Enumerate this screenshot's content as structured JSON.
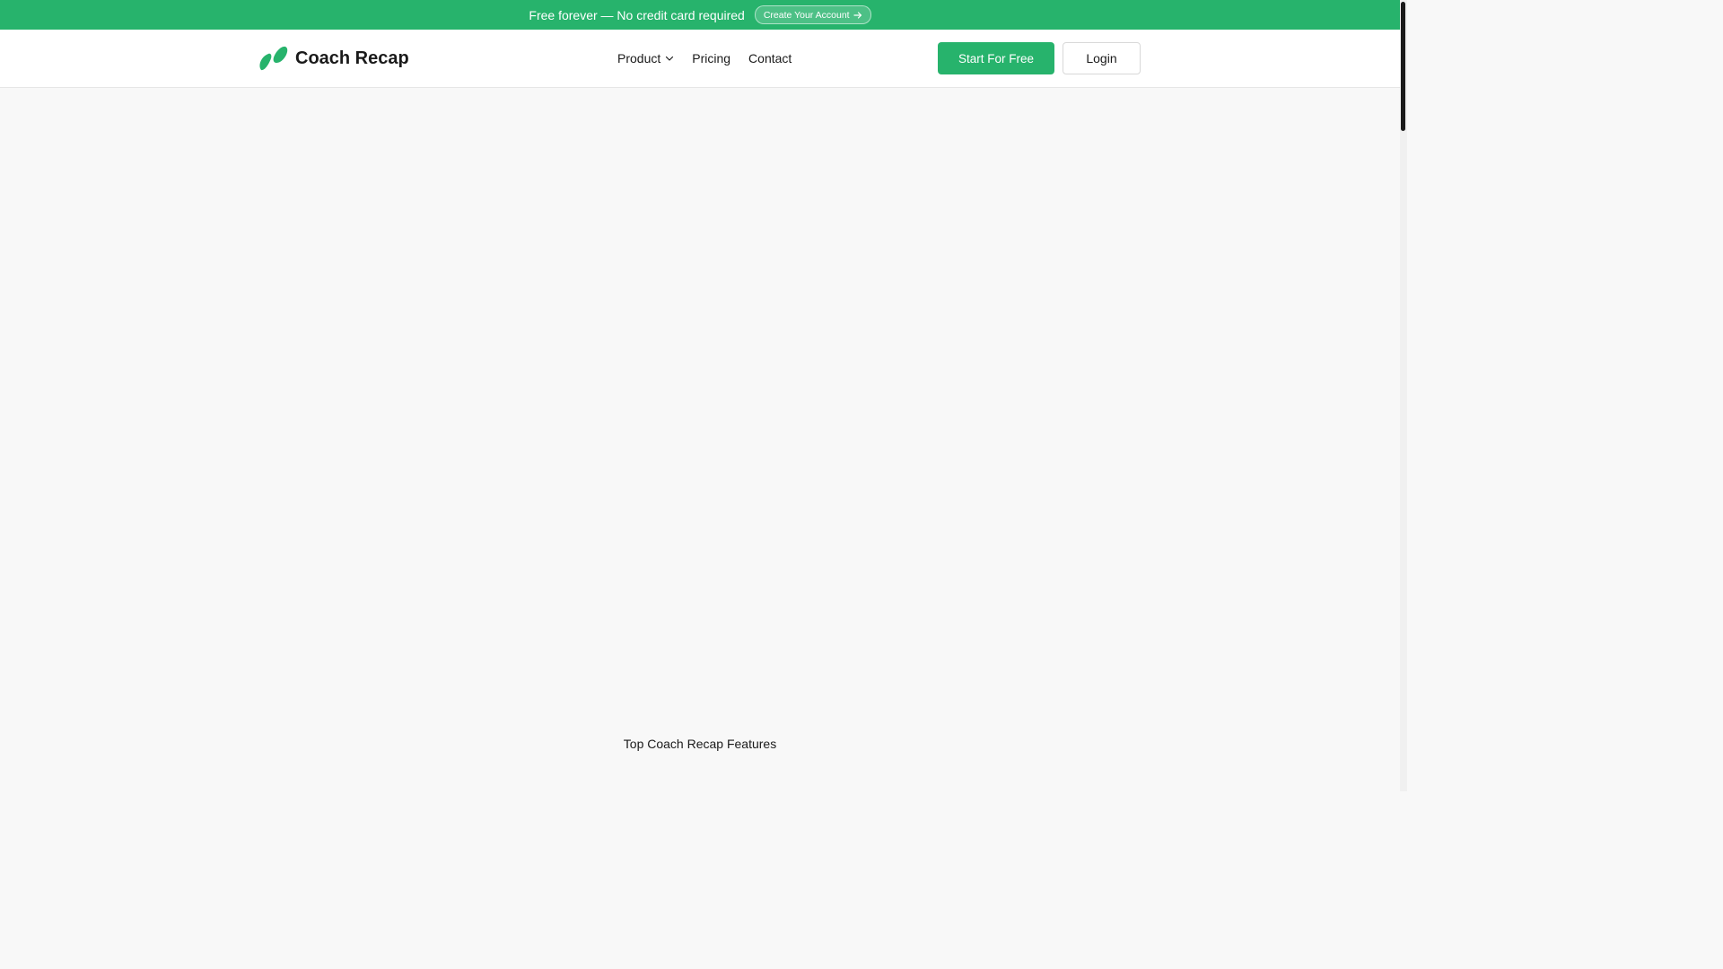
{
  "promo": {
    "text": "Free forever — No credit card required",
    "cta_label": "Create Your Account"
  },
  "header": {
    "brand_name": "Coach Recap",
    "nav": [
      {
        "label": "Product",
        "has_dropdown": true
      },
      {
        "label": "Pricing"
      },
      {
        "label": "Contact"
      }
    ],
    "start_label": "Start For Free",
    "login_label": "Login"
  },
  "main": {
    "features_heading": "Top Coach Recap Features"
  },
  "colors": {
    "brand_green": "#27b36c",
    "page_background": "#f8f8f8"
  },
  "icons": {
    "logo": "coach-recap-logo-icon",
    "dropdown": "chevron-down-icon",
    "cta": "arrow-right-icon"
  }
}
